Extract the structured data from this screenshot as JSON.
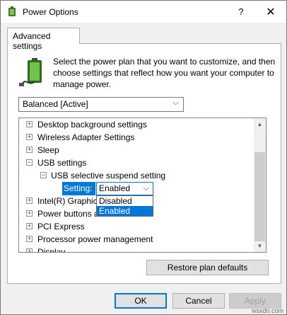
{
  "window": {
    "title": "Power Options",
    "help_glyph": "?",
    "close_glyph": "✕"
  },
  "tab": {
    "label": "Advanced settings"
  },
  "description": "Select the power plan that you want to customize, and then choose settings that reflect how you want your computer to manage power.",
  "plan_select": {
    "value": "Balanced [Active]",
    "arrow": "⌵"
  },
  "tree": {
    "items": [
      {
        "label": "Desktop background settings",
        "expander": "+"
      },
      {
        "label": "Wireless Adapter Settings",
        "expander": "+"
      },
      {
        "label": "Sleep",
        "expander": "+"
      },
      {
        "label": "USB settings",
        "expander": "−"
      },
      {
        "label": "USB selective suspend setting",
        "expander": "−"
      },
      {
        "label": "Intel(R) Graphic",
        "expander": "+"
      },
      {
        "label": "Power buttons a",
        "expander": "+"
      },
      {
        "label": "PCI Express",
        "expander": "+"
      },
      {
        "label": "Processor power management",
        "expander": "+"
      },
      {
        "label": "Display",
        "expander": "+"
      }
    ],
    "setting": {
      "label": "Setting:",
      "value": "Enabled",
      "arrow": "⌵",
      "options": [
        "Disabled",
        "Enabled"
      ],
      "selected_option": "Enabled"
    },
    "scroll_up": "▲",
    "scroll_down": "▼"
  },
  "buttons": {
    "restore": "Restore plan defaults",
    "ok": "OK",
    "cancel": "Cancel",
    "apply": "Apply"
  },
  "watermark": "wsxdn.com",
  "colors": {
    "accent": "#0078d7",
    "dialog_bg": "#f0f0f0",
    "button_bg": "#e1e1e1"
  }
}
